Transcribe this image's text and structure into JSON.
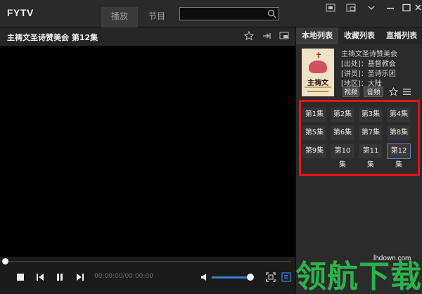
{
  "app": {
    "title": "FYTV"
  },
  "tabs": {
    "play": "播放",
    "program": "节目"
  },
  "search": {
    "value": "",
    "placeholder": ""
  },
  "video": {
    "title": "主祷文圣诗赞美会 第12集"
  },
  "player": {
    "time": "00:00:00/00:00:00",
    "progress": 0,
    "volume": 0.85
  },
  "panel": {
    "tabs": [
      "本地列表",
      "收藏列表",
      "直播列表"
    ],
    "active_tab": 0,
    "program": {
      "title": "主祷文圣诗赞美会",
      "source": "[出处]：基督教会",
      "speaker": "[讲员]：圣诗乐团",
      "region": "[地区]：大陆",
      "cover_title": "主祷文",
      "media_tags": [
        "视频",
        "音频"
      ]
    },
    "episodes": [
      "第1集",
      "第2集",
      "第3集",
      "第4集",
      "第5集",
      "第6集",
      "第7集",
      "第8集",
      "第9集",
      "第10集",
      "第11集",
      "第12集"
    ],
    "selected_episode": 11
  },
  "watermark": {
    "site": "lhdown.com",
    "text": "领航下载"
  },
  "colors": {
    "accent": "#3a7bd5",
    "highlight_border": "#e51515",
    "watermark": "#2bb34b"
  }
}
